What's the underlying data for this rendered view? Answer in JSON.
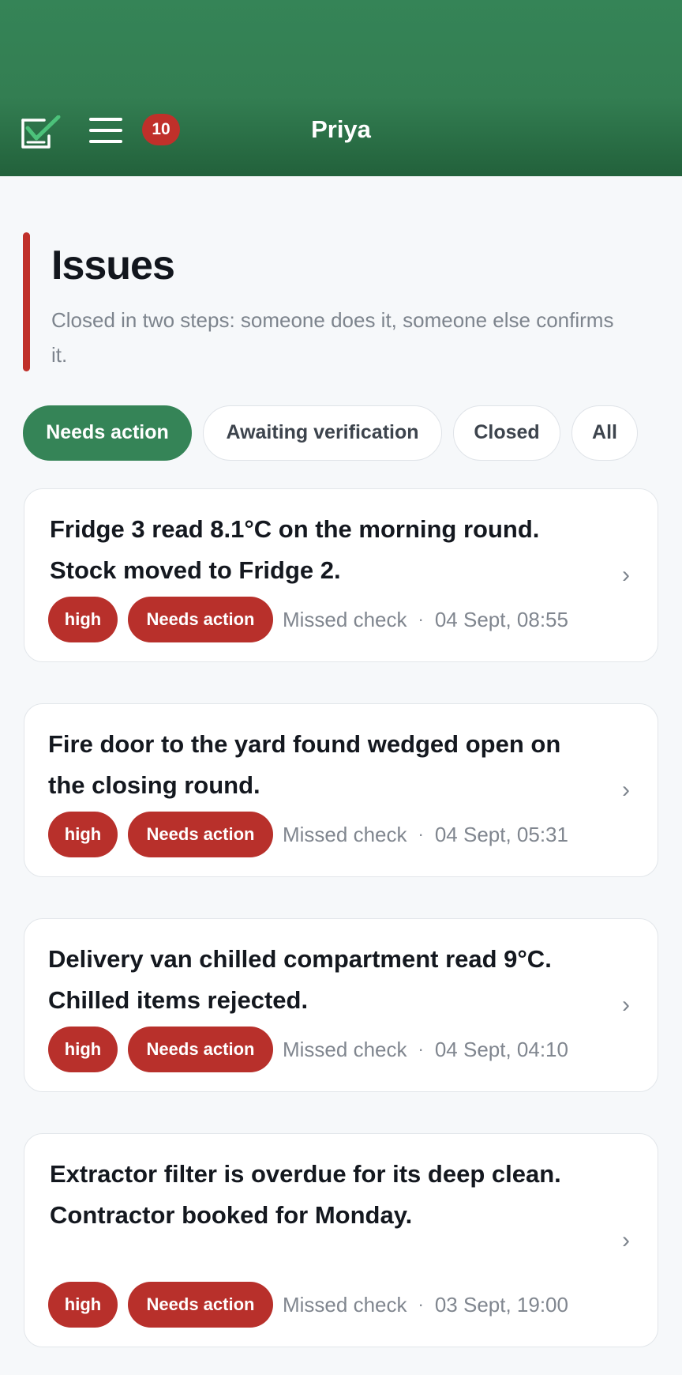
{
  "header": {
    "badge_count": "10",
    "user_name": "Priya",
    "logo_icon": "checklist-icon",
    "menu_icon": "hamburger-menu-icon"
  },
  "page": {
    "title": "Issues",
    "subtitle": "Closed in two steps: someone does it, someone else confirms it."
  },
  "filters": [
    {
      "label": "Needs action",
      "active": true
    },
    {
      "label": "Awaiting verification",
      "active": false
    },
    {
      "label": "Closed",
      "active": false
    },
    {
      "label": "All",
      "active": false
    }
  ],
  "issues": [
    {
      "title": "Fridge 3 read 8.1°C on the morning round. Stock moved to Fridge 2.",
      "priority": "high",
      "status": "Needs action",
      "type": "Missed check",
      "separator": "·",
      "time": "04 Sept, 08:55"
    },
    {
      "title": "Fire door to the yard found wedged open on the closing round.",
      "priority": "high",
      "status": "Needs action",
      "type": "Missed check",
      "separator": "·",
      "time": "04 Sept, 05:31"
    },
    {
      "title": "Delivery van chilled compartment read 9°C. Chilled items rejected.",
      "priority": "high",
      "status": "Needs action",
      "type": "Missed check",
      "separator": "·",
      "time": "04 Sept, 04:10"
    },
    {
      "title": "Extractor filter is overdue for its deep clean. Contractor booked for Monday.",
      "priority": "high",
      "status": "Needs action",
      "type": "Missed check",
      "separator": "·",
      "time": "03 Sept, 19:00"
    }
  ],
  "chevron_glyph": "›",
  "colors": {
    "brand_green": "#358457",
    "alert_red": "#c0302a",
    "muted_text": "#80868f"
  }
}
